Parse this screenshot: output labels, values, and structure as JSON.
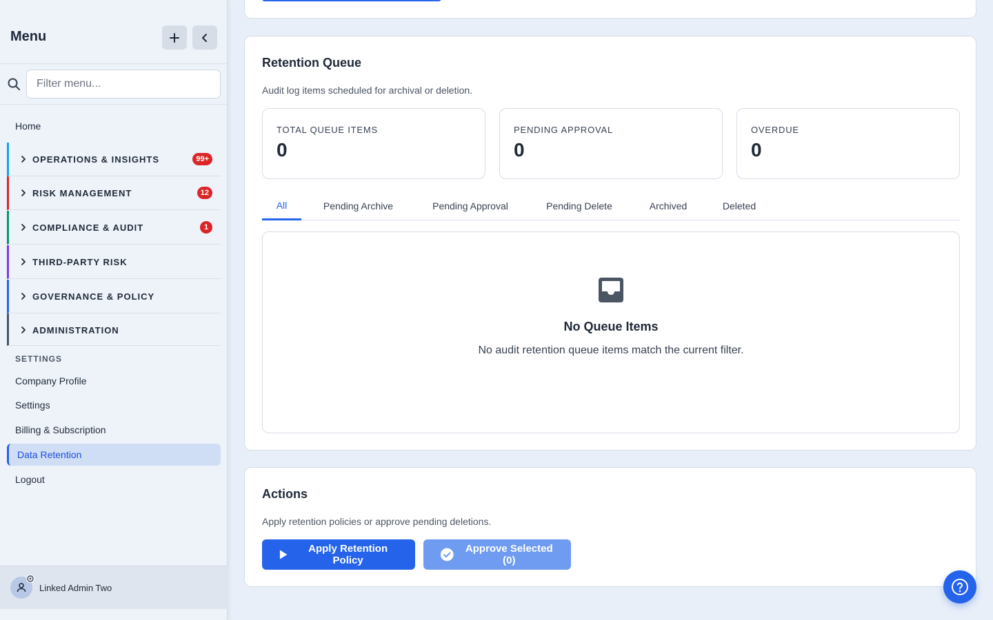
{
  "sidebar": {
    "title": "Menu",
    "filter_placeholder": "Filter menu...",
    "home": "Home",
    "groups": [
      {
        "label": "OPERATIONS & INSIGHTS",
        "badge": "99+",
        "color": "#0ea5e9"
      },
      {
        "label": "RISK MANAGEMENT",
        "badge": "12",
        "color": "#dc2626"
      },
      {
        "label": "COMPLIANCE & AUDIT",
        "badge": "1",
        "color": "#059669"
      },
      {
        "label": "THIRD-PARTY RISK",
        "badge": "",
        "color": "#7c3aed"
      },
      {
        "label": "GOVERNANCE & POLICY",
        "badge": "",
        "color": "#2563eb"
      },
      {
        "label": "ADMINISTRATION",
        "badge": "",
        "color": "#475569"
      }
    ],
    "settings_heading": "SETTINGS",
    "settings_items": [
      "Company Profile",
      "Settings",
      "Billing & Subscription",
      "Data Retention",
      "Logout"
    ],
    "active_item": "Data Retention",
    "user_name": "Linked Admin Two"
  },
  "retention_queue": {
    "title": "Retention Queue",
    "description": "Audit log items scheduled for archival or deletion.",
    "stats": [
      {
        "label": "TOTAL QUEUE ITEMS",
        "value": "0"
      },
      {
        "label": "PENDING APPROVAL",
        "value": "0"
      },
      {
        "label": "OVERDUE",
        "value": "0"
      }
    ],
    "tabs": [
      "All",
      "Pending Archive",
      "Pending Approval",
      "Pending Delete",
      "Archived",
      "Deleted"
    ],
    "active_tab": "All",
    "empty_title": "No Queue Items",
    "empty_description": "No audit retention queue items match the current filter."
  },
  "actions": {
    "title": "Actions",
    "description": "Apply retention policies or approve pending deletions.",
    "apply_label": "Apply Retention Policy",
    "approve_label": "Approve Selected (0)"
  },
  "colors": {
    "accent": "#2563eb",
    "badge": "#dc2626",
    "active_nav_bg": "#cfddf5"
  }
}
